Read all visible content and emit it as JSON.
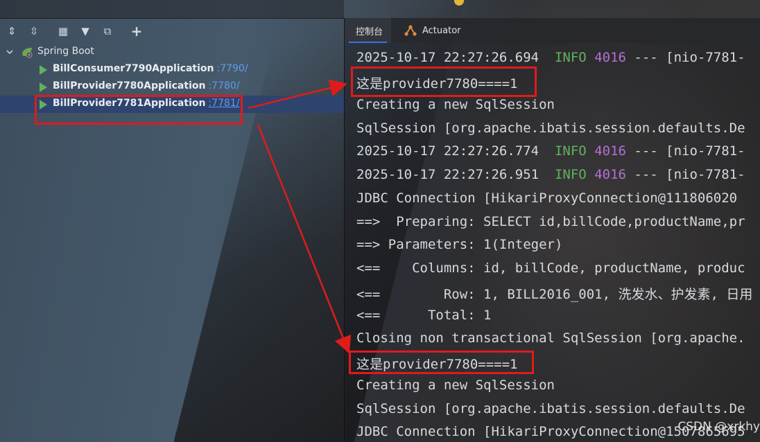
{
  "left_panel": {
    "toolbar": {
      "buttons": [
        {
          "icon": "expand-all-icon",
          "glyph": "⇕"
        },
        {
          "icon": "collapse-all-icon",
          "glyph": "⇳"
        },
        {
          "icon": "group-by-icon",
          "glyph": "▦"
        },
        {
          "icon": "filter-icon",
          "glyph": "▼"
        },
        {
          "icon": "new-window-icon",
          "glyph": "⧉"
        },
        {
          "icon": "add-icon",
          "glyph": "+"
        }
      ]
    },
    "tree": {
      "root_label": "Spring Boot",
      "items": [
        {
          "name": "BillConsumer7790Application",
          "port": ":7790/"
        },
        {
          "name": "BillProvider7780Application",
          "port": ":7780/"
        },
        {
          "name": "BillProvider7781Application",
          "port": ":7781/"
        }
      ]
    }
  },
  "right_panel": {
    "tabs": {
      "console_label": "控制台",
      "actuator_label": "Actuator"
    },
    "console_lines": [
      {
        "a": "2025-10-17 22:27:26.694  ",
        "level": "INFO",
        "pid": "4016",
        "rest": " --- [nio-7781-"
      },
      {
        "text": "这是provider7780====1"
      },
      {
        "text": "Creating a new SqlSession"
      },
      {
        "text": "SqlSession [org.apache.ibatis.session.defaults.De"
      },
      {
        "a": "2025-10-17 22:27:26.774  ",
        "level": "INFO",
        "pid": "4016",
        "rest": " --- [nio-7781-"
      },
      {
        "a": "2025-10-17 22:27:26.951  ",
        "level": "INFO",
        "pid": "4016",
        "rest": " --- [nio-7781-"
      },
      {
        "text": "JDBC Connection [HikariProxyConnection@111806020"
      },
      {
        "text": "==>  Preparing: SELECT id,billCode,productName,pr"
      },
      {
        "text": "==> Parameters: 1(Integer)"
      },
      {
        "text": "<==    Columns: id, billCode, productName, produc"
      },
      {
        "text": "<==        Row: 1, BILL2016_001, 洗发水、护发素, 日用"
      },
      {
        "text": "<==      Total: 1"
      },
      {
        "text": "Closing non transactional SqlSession [org.apache."
      },
      {
        "text": "这是provider7780====1"
      },
      {
        "text": "Creating a new SqlSession"
      },
      {
        "text": "SqlSession [org.apache.ibatis.session.defaults.De"
      },
      {
        "text": "JDBC Connection [HikariProxyConnection@1507865695"
      }
    ],
    "watermark": "CSDN @xrkhy"
  },
  "colors": {
    "info_level": "#5fb35f",
    "pid": "#b46fd6",
    "port_link": "#5e9de8",
    "selection": "#2e436e",
    "annotation_red": "#e01b1b",
    "tab_underline": "#3574f0"
  }
}
